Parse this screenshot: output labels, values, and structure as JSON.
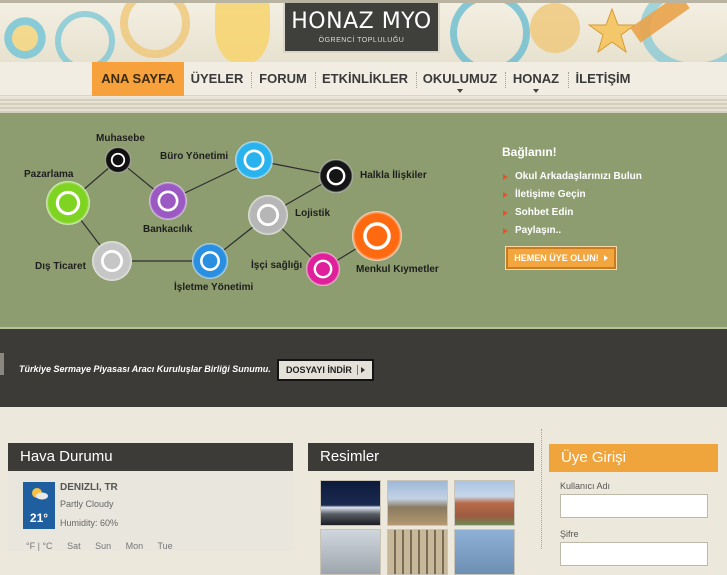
{
  "header": {
    "logo_title": "HONAZ MYO",
    "logo_subtitle": "ÖGRENCİ TOPLULUĞU",
    "accent_color": "#f6a13b"
  },
  "nav": {
    "items": [
      {
        "label": "ANA SAYFA",
        "active": true
      },
      {
        "label": "ÜYELER"
      },
      {
        "label": "FORUM"
      },
      {
        "label": "ETKİNLİKLER"
      },
      {
        "label": "OKULUMUZ",
        "dropdown": true
      },
      {
        "label": "HONAZ",
        "dropdown": true
      },
      {
        "label": "İLETİŞİM"
      }
    ]
  },
  "diagram": {
    "nodes": [
      {
        "label": "Muhasebe",
        "color": "#111111"
      },
      {
        "label": "Büro Yönetimi",
        "color": "#29b3ee"
      },
      {
        "label": "Pazarlama",
        "color": "#7fd321"
      },
      {
        "label": "Bankacılık",
        "color": "#9b59c4"
      },
      {
        "label": "Halkla İlişkiler",
        "color": "#151515"
      },
      {
        "label": "Lojistik",
        "color": "#b6b6b6"
      },
      {
        "label": "Dış Ticaret",
        "color": "#c6c6c6"
      },
      {
        "label": "İşletme Yönetimi",
        "color": "#2a8fe0"
      },
      {
        "label": "İşçi sağlığı",
        "color": "#e0209a"
      },
      {
        "label": "Menkul Kıymetler",
        "color": "#ff6a10"
      }
    ]
  },
  "join": {
    "title": "Bağlanın!",
    "items": [
      "Okul Arkadaşlarınızı Bulun",
      "İletişime Geçin",
      "Sohbet Edin",
      "Paylaşın.."
    ],
    "button_label": "HEMEN ÜYE OLUN!"
  },
  "banner": {
    "text": "Türkiye Sermaye Piyasası Aracı Kuruluşlar Birliği Sunumu.",
    "button_label": "DOSYAYI İNDİR"
  },
  "weather": {
    "title": "Hava Durumu",
    "city": "DENIZLI, TR",
    "condition": "Partly Cloudy",
    "humidity": "Humidity: 60%",
    "temperature": "21°",
    "days": [
      "°F | °C",
      "Sat",
      "Sun",
      "Mon",
      "Tue"
    ]
  },
  "photos": {
    "title": "Resimler"
  },
  "login": {
    "title": "Üye Girişi",
    "username_label": "Kullanıcı Adı",
    "password_label": "Şifre"
  }
}
